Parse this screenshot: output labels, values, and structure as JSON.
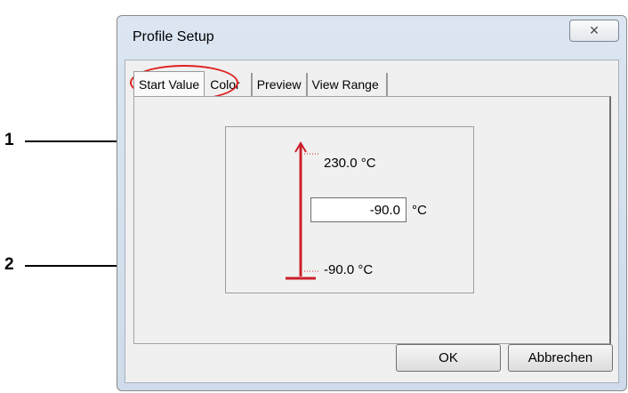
{
  "dialog": {
    "title": "Profile Setup",
    "close_glyph": "✕"
  },
  "tabs": [
    {
      "label": "Start Value",
      "active": true
    },
    {
      "label": "Color",
      "active": false
    },
    {
      "label": "Preview",
      "active": false
    },
    {
      "label": "View Range",
      "active": false
    }
  ],
  "start_value": {
    "top_label": "230.0 °C",
    "bottom_label": "-90.0 °C",
    "input_value": "-90.0",
    "unit": "°C"
  },
  "buttons": {
    "ok": "OK",
    "cancel": "Abbrechen"
  },
  "callouts": {
    "one": "1",
    "two": "2"
  },
  "colors": {
    "marker": "#e02020",
    "scale": "#cc1f2b"
  }
}
